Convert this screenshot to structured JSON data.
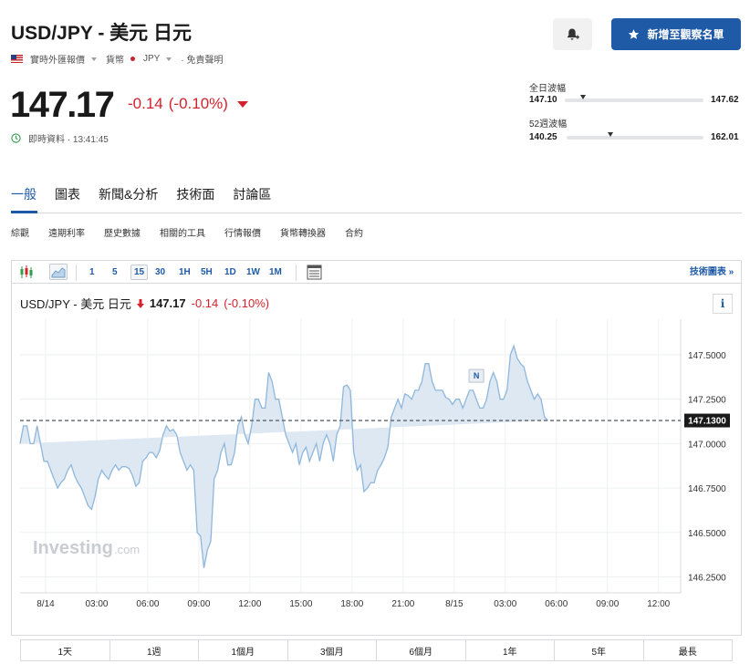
{
  "header": {
    "title": "USD/JPY - 美元 日元",
    "subline": {
      "realtime_quotes": "實時外匯報價",
      "currency": "貨幣",
      "jpy": "JPY",
      "disclaimer": "· 免責聲明"
    },
    "watchlist_button": "新增至觀察名單"
  },
  "quote": {
    "price": "147.17",
    "change": "-0.14",
    "change_pct": "(-0.10%)",
    "realtime_text": "即時資料 · 13:41:45",
    "colors": {
      "down": "#d4212c",
      "accent": "#1f5aa6"
    }
  },
  "ranges": {
    "day": {
      "label": "全日波幅",
      "low": "147.10",
      "high": "147.62",
      "current_fraction": 0.13
    },
    "week52": {
      "label": "52週波幅",
      "low": "140.25",
      "high": "162.01",
      "current_fraction": 0.32
    }
  },
  "tabs": [
    "一般",
    "圖表",
    "新聞&分析",
    "技術面",
    "討論區"
  ],
  "subtabs": [
    "綜觀",
    "遠期利率",
    "歷史數據",
    "相關的工具",
    "行情報價",
    "貨幣轉換器",
    "合約"
  ],
  "toolbar": {
    "chart_type_icons": [
      "candlestick-icon",
      "area-chart-icon"
    ],
    "intervals": [
      "1",
      "5",
      "15",
      "30",
      "1H",
      "5H",
      "1D",
      "1W",
      "1M"
    ],
    "selected_interval": "15",
    "technical_chart_link": "技術圖表 »"
  },
  "chart_header": {
    "title": "USD/JPY - 美元 日元",
    "price": "147.17",
    "change": "-0.14",
    "change_pct": "(-0.10%)",
    "info": "i"
  },
  "watermark": {
    "brand": "Investing",
    "suffix": ".com"
  },
  "news_marker": "N",
  "periods": [
    "1天",
    "1週",
    "1個月",
    "3個月",
    "6個月",
    "1年",
    "5年",
    "最長"
  ],
  "chart_data": {
    "type": "area",
    "title": "USD/JPY - 美元 日元",
    "ylim": [
      146.16,
      147.7
    ],
    "yticks": [
      "147.5000",
      "147.2500",
      "147.0000",
      "146.7500",
      "146.5000",
      "146.2500"
    ],
    "ytick_values": [
      147.5,
      147.25,
      147.0,
      146.75,
      146.5,
      146.25
    ],
    "xticks": [
      "8/14",
      "03:00",
      "06:00",
      "09:00",
      "12:00",
      "15:00",
      "18:00",
      "21:00",
      "8/15",
      "03:00",
      "06:00",
      "09:00",
      "12:00"
    ],
    "xtick_hours": [
      0,
      3,
      6,
      9,
      12,
      15,
      18,
      21,
      24,
      27,
      30,
      33,
      36
    ],
    "reference_line": {
      "value": 147.13,
      "label": "147.1300"
    },
    "x_hours": [
      -1.5,
      -1.3,
      -1.1,
      -0.9,
      -0.7,
      -0.5,
      -0.3,
      -0.1,
      0.1,
      0.3,
      0.5,
      0.7,
      0.9,
      1.1,
      1.3,
      1.5,
      1.7,
      1.9,
      2.1,
      2.3,
      2.5,
      2.7,
      2.9,
      3.1,
      3.3,
      3.5,
      3.7,
      3.9,
      4.1,
      4.3,
      4.5,
      4.7,
      4.9,
      5.1,
      5.3,
      5.5,
      5.7,
      5.9,
      6.1,
      6.3,
      6.5,
      6.7,
      6.9,
      7.1,
      7.3,
      7.5,
      7.7,
      7.9,
      8.1,
      8.3,
      8.5,
      8.7,
      8.9,
      9.1,
      9.3,
      9.5,
      9.7,
      9.9,
      10.1,
      10.3,
      10.5,
      10.7,
      10.9,
      11.1,
      11.3,
      11.5,
      11.7,
      11.9,
      12.1,
      12.3,
      12.5,
      12.7,
      12.9,
      13.1,
      13.3,
      13.5,
      13.7,
      13.9,
      14.1,
      14.3,
      14.5,
      14.7,
      14.9,
      15.1,
      15.3,
      15.5,
      15.7,
      15.9,
      16.1,
      16.3,
      16.5,
      16.7,
      16.9,
      17.1,
      17.3,
      17.5,
      17.7,
      17.9,
      18.1,
      18.3,
      18.5,
      18.7,
      18.9,
      19.1,
      19.3,
      19.5,
      19.7,
      19.9,
      20.1,
      20.3,
      20.5,
      20.7,
      20.9,
      21.1,
      21.3,
      21.5,
      21.7,
      21.9,
      22.1,
      22.3,
      22.5,
      22.7,
      22.9,
      23.1,
      23.3,
      23.5,
      23.7,
      23.9,
      24.1,
      24.3,
      24.5,
      24.7,
      24.9,
      25.1,
      25.3,
      25.5,
      25.7,
      25.9,
      26.1,
      26.3,
      26.5,
      26.7,
      26.9,
      27.1,
      27.3,
      27.5,
      27.7,
      27.9,
      28.1,
      28.3,
      28.5,
      28.7,
      28.9,
      29.1,
      29.3,
      29.5,
      29.7,
      29.9,
      30.1,
      30.3,
      30.5,
      30.7,
      30.9,
      31.1,
      31.3,
      31.5,
      31.7,
      31.9,
      32.1,
      32.3,
      32.5,
      32.7,
      32.9,
      33.1,
      33.3,
      33.5,
      33.7,
      33.9,
      34.1,
      34.3,
      34.5,
      34.7,
      34.9,
      35.1,
      35.3,
      35.5,
      35.7,
      35.9,
      36.1,
      36.3,
      36.5,
      36.7,
      36.9,
      37.1
    ],
    "y_values": [
      147.0,
      147.1,
      147.1,
      147.0,
      147.0,
      147.1,
      147.0,
      146.9,
      146.9,
      146.85,
      146.8,
      146.75,
      146.78,
      146.8,
      146.85,
      146.88,
      146.82,
      146.78,
      146.75,
      146.7,
      146.65,
      146.63,
      146.7,
      146.8,
      146.85,
      146.82,
      146.8,
      146.85,
      146.88,
      146.85,
      146.87,
      146.87,
      146.86,
      146.82,
      146.76,
      146.78,
      146.9,
      146.92,
      146.95,
      146.95,
      146.92,
      146.96,
      147.05,
      147.1,
      147.07,
      147.08,
      147.05,
      146.95,
      146.9,
      146.85,
      146.88,
      146.85,
      146.5,
      146.48,
      146.3,
      146.4,
      146.45,
      146.8,
      146.85,
      146.95,
      147.0,
      146.88,
      146.88,
      146.95,
      147.1,
      147.15,
      147.05,
      147.0,
      147.1,
      147.25,
      147.25,
      147.2,
      147.2,
      147.4,
      147.35,
      147.25,
      147.25,
      147.15,
      147.05,
      147.0,
      146.95,
      147.0,
      146.88,
      146.95,
      146.98,
      146.9,
      146.95,
      147.0,
      146.9,
      147.0,
      147.05,
      147.0,
      146.9,
      147.05,
      147.1,
      147.32,
      147.33,
      147.3,
      146.95,
      146.85,
      146.88,
      146.73,
      146.75,
      146.78,
      146.78,
      146.85,
      146.88,
      146.92,
      146.98,
      147.15,
      147.2,
      147.25,
      147.2,
      147.28,
      147.27,
      147.25,
      147.3,
      147.3,
      147.35,
      147.45,
      147.45,
      147.35,
      147.3,
      147.3,
      147.3,
      147.26,
      147.25,
      147.22,
      147.25,
      147.25,
      147.2,
      147.25,
      147.3,
      147.3,
      147.25,
      147.2,
      147.2,
      147.25,
      147.35,
      147.4,
      147.35,
      147.25,
      147.25,
      147.3,
      147.5,
      147.55,
      147.48,
      147.45,
      147.43,
      147.35,
      147.3,
      147.25,
      147.28,
      147.25,
      147.15,
      147.13
    ]
  }
}
